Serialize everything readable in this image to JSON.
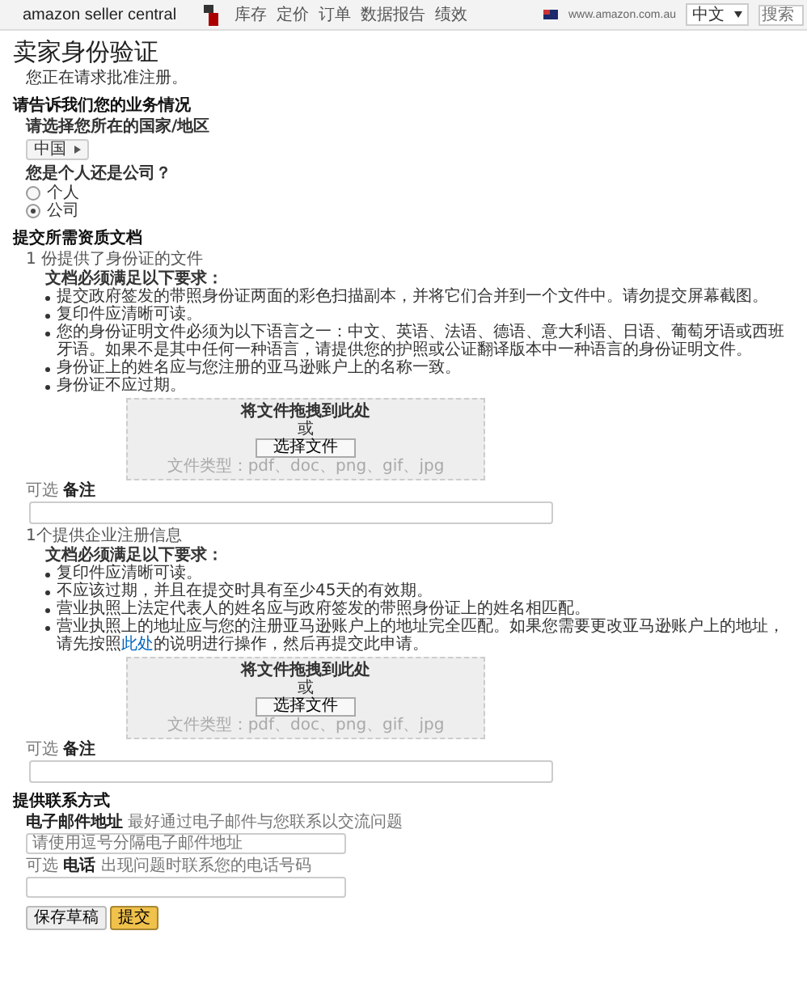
{
  "header": {
    "logo": "amazon seller central",
    "nav": [
      "库存",
      "定价",
      "订单",
      "数据报告",
      "绩效"
    ],
    "site": "www.amazon.com.au",
    "language": "中文",
    "search_placeholder": "搜索"
  },
  "title": "卖家身份验证",
  "subtitle": "您正在请求批准注册。",
  "business": {
    "heading": "请告诉我们您的业务情况",
    "country_label": "请选择您所在的国家/地区",
    "country": "中国",
    "type_label": "您是个人还是公司？",
    "types": [
      {
        "label": "个人",
        "selected": false
      },
      {
        "label": "公司",
        "selected": true
      }
    ]
  },
  "documents": {
    "heading": "提交所需资质文档",
    "items": [
      {
        "label": "1 份提供了身份证的文件",
        "requirements_title": "文档必须满足以下要求：",
        "requirements": [
          {
            "text": "提交政府签发的带照身份证两面的彩色扫描副本，并将它们合并到一个文件中。请勿提交屏幕截图。"
          },
          {
            "text": "复印件应清晰可读。"
          },
          {
            "text": "您的身份证明文件必须为以下语言之一：中文、英语、法语、德语、意大利语、日语、葡萄牙语或西班牙语。如果不是其中任何一种语言，请提供您的护照或公证翻译版本中一种语言的身份证明文件。"
          },
          {
            "text": "身份证上的姓名应与您注册的亚马逊账户上的名称一致。"
          },
          {
            "text": "身份证不应过期。"
          }
        ],
        "drop_text": "将文件拖拽到此处",
        "or": "或",
        "choose": "选择文件",
        "types": "文件类型：pdf、doc、png、gif、jpg",
        "note_label": "可选 **备注**"
      },
      {
        "label": "1个提供企业注册信息",
        "requirements_title": "文档必须满足以下要求：",
        "requirements": [
          {
            "text": "复印件应清晰可读。"
          },
          {
            "text": "不应该过期，并且在提交时具有至少45天的有效期。"
          },
          {
            "text": "营业执照上法定代表人的姓名应与政府签发的带照身份证上的姓名相匹配。"
          },
          {
            "text": "营业执照上的地址应与您的注册亚马逊账户上的地址完全匹配。如果您需要更改亚马逊账户上的地址，请先按照",
            "link": "此处",
            "after": "的说明进行操作，然后再提交此申请。"
          }
        ],
        "drop_text": "将文件拖拽到此处",
        "or": "或",
        "choose": "选择文件",
        "types": "文件类型：pdf、doc、png、gif、jpg",
        "note_label": "可选 **备注**"
      }
    ]
  },
  "contact": {
    "heading": "提供联系方式",
    "email_label": "**电子邮件地址** 最好通过电子邮件与您联系以交流问题",
    "email_placeholder": "请使用逗号分隔电子邮件地址",
    "phone_label": "可选 **电话** 出现问题时联系您的电话号码"
  },
  "buttons": [
    {
      "label": "保存草稿",
      "kind": "secondary"
    },
    {
      "label": "提交",
      "kind": "primary"
    }
  ]
}
